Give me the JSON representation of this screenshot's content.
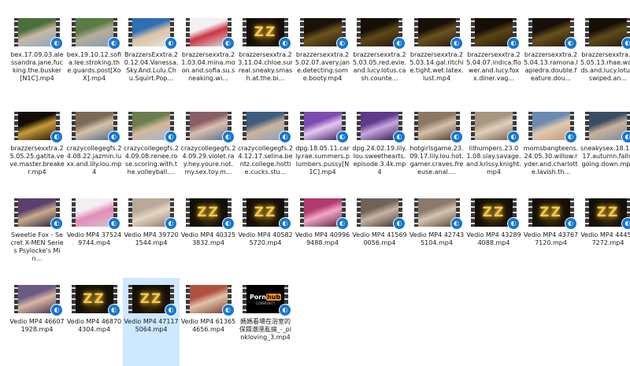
{
  "files": [
    {
      "label": "bex.17.09.03.alessandra.jane.fucking.the.busker[N1C].mp4",
      "thumb": "outdoor",
      "colors": [
        "#4c6f3a",
        "#c8b9a4",
        "#8aa6c3"
      ]
    },
    {
      "label": "bex.19.10.12.sofia.lee.stroking.the.guards.post[XoX].mp4",
      "thumb": "outdoor",
      "colors": [
        "#5b7b45",
        "#b8ad9a",
        "#7f9bb9"
      ]
    },
    {
      "label": "BrazzersExxtra.20.12.04.Vanessa.Sky.And.Lulu.Chu.Squirt.Pop...",
      "thumb": "room",
      "colors": [
        "#2f6fb3",
        "#d9c3a6",
        "#e8e2d9"
      ]
    },
    {
      "label": "brazzersexxtra.21.03.04.mina.moon.and.sofia.su.sneaking.wi...",
      "thumb": "white",
      "colors": [
        "#f1f1f1",
        "#cc3344",
        "#dddddd"
      ]
    },
    {
      "label": "brazzersexxtra.23.11.04.chloe.surreal.sneaky.smash.at.the.bi...",
      "thumb": "zz",
      "colors": []
    },
    {
      "label": "brazzersexxtra.25.02.07.avery.jane.detecting.some.booty.mp4",
      "thumb": "dark",
      "colors": [
        "#1a1208",
        "#6b5320",
        "#2a1e0c"
      ]
    },
    {
      "label": "brazzersexxtra.25.03.05.red.evie.and.lucy.lotus.cash.counte...",
      "thumb": "dark",
      "colors": [
        "#160f06",
        "#5e4818",
        "#241a0a"
      ]
    },
    {
      "label": "brazzersexxtra.25.03.14.gal.ritchie.tight.wet.latex.lust.mp4",
      "thumb": "dark",
      "colors": [
        "#18110a",
        "#6a521e",
        "#261b0c"
      ]
    },
    {
      "label": "brazzersexxtra.25.04.07.indica.flower.and.lucy.foxx.diner.vag...",
      "thumb": "dark",
      "colors": [
        "#140e06",
        "#5a4416",
        "#22190a"
      ]
    },
    {
      "label": "brazzersexxtra.25.04.13.ramona.lapiedra.double.feature.dou...",
      "thumb": "dark",
      "colors": [
        "#17100a",
        "#66501c",
        "#271c0c"
      ]
    },
    {
      "label": "brazzersexxtra.25.05.13.rhae.woods.and.lucy.lotus.swiped.an...",
      "thumb": "dark",
      "colors": [
        "#150f07",
        "#5f4a1a",
        "#241a0b"
      ]
    },
    {
      "label": "brazzersexxtra.25.05.25.gatita.veve.master.breaker.mp4",
      "thumb": "dark",
      "colors": [
        "#130d06",
        "#c99a3a",
        "#221809"
      ]
    },
    {
      "label": "crazycollegegfs.24.08.22.jazmin.luxx.and.lily.lou.mp4",
      "thumb": "room",
      "colors": [
        "#7b6a58",
        "#d7c2a8",
        "#4d6b86"
      ]
    },
    {
      "label": "crazycollegegfs.24.09.08.renee.rose.scoring.with.the.volleyball....",
      "thumb": "room",
      "colors": [
        "#6c7d4e",
        "#d3b89c",
        "#a1b4c9"
      ]
    },
    {
      "label": "crazycollegegfs.24.09.29.violet.ray.hey.youre.not.my.sex.toy.m...",
      "thumb": "room",
      "colors": [
        "#8a5f66",
        "#d9bfae",
        "#5a6f8c"
      ]
    },
    {
      "label": "crazycollegegfs.24.12.17.selina.bentz.college.hottie.cucks.stu...",
      "thumb": "room",
      "colors": [
        "#3f5d7d",
        "#cfb39a",
        "#86a0bb"
      ]
    },
    {
      "label": "dpg.18.05.11.carly.rae.summers.plumbers.pussy[N1C].mp4",
      "thumb": "purple",
      "colors": [
        "#7d4bb0",
        "#e7c8f2",
        "#3a2160"
      ]
    },
    {
      "label": "dpg.24.02.19.lily.lou.sweethearts.episode.3.4k.mp4",
      "thumb": "purple",
      "colors": [
        "#5e3a8a",
        "#c8a6df",
        "#2d1a4a"
      ]
    },
    {
      "label": "hotgirlsgame.23.09.17.lily.lou.hot.gamer.craves.freeuse.anal....",
      "thumb": "room",
      "colors": [
        "#8c7865",
        "#d6c2aa",
        "#4a3a2c"
      ]
    },
    {
      "label": "lilhumpers.23.01.08.slay.savage.and.krissy.knight.mp4",
      "thumb": "room",
      "colors": [
        "#a89682",
        "#e0d0bc",
        "#6f5f50"
      ]
    },
    {
      "label": "momsbangteens.24.05.30.willow.ryder.and.charlotte.lavish.th...",
      "thumb": "room",
      "colors": [
        "#6a8ab0",
        "#e0c9b0",
        "#c49a78"
      ]
    },
    {
      "label": "sneakysex.18.11.17.autumn.falls.going.down.mp4",
      "thumb": "room",
      "colors": [
        "#3a4e63",
        "#c9b19a",
        "#7a8c9e"
      ]
    },
    {
      "label": "Sweetie Fox - Secret X-MEN Series Psylocke's Min...",
      "thumb": "room",
      "colors": [
        "#5b3f6e",
        "#caa98e",
        "#2f2338"
      ]
    },
    {
      "label": "Vedio MP4 375249744.mp4",
      "thumb": "white",
      "colors": [
        "#f3eef2",
        "#e58bb8",
        "#cfc6cc"
      ]
    },
    {
      "label": "Vedio MP4 397201544.mp4",
      "thumb": "room",
      "colors": [
        "#b8a999",
        "#e6d6c4",
        "#8b7a6a"
      ]
    },
    {
      "label": "Vedio MP4 403253832.mp4",
      "thumb": "zz",
      "colors": []
    },
    {
      "label": "Vedio MP4 405825720.mp4",
      "thumb": "zz",
      "colors": []
    },
    {
      "label": "Vedio MP4 409969488.mp4",
      "thumb": "pink",
      "colors": [
        "#b33a6e",
        "#f1a6c8",
        "#5a1f3a"
      ]
    },
    {
      "label": "Vedio MP4 415690056.mp4",
      "thumb": "room",
      "colors": [
        "#6f6358",
        "#c8b4a0",
        "#3b342d"
      ]
    },
    {
      "label": "Vedio MP4 427435104.mp4",
      "thumb": "room",
      "colors": [
        "#8a7a6a",
        "#d8c4ae",
        "#514538"
      ]
    },
    {
      "label": "Vedio MP4 432894088.mp4",
      "thumb": "zz",
      "colors": []
    },
    {
      "label": "Vedio MP4 437677120.mp4",
      "thumb": "zz",
      "colors": []
    },
    {
      "label": "Vedio MP4 444597272.mp4",
      "thumb": "zz",
      "colors": []
    },
    {
      "label": "Vedio MP4 466071928.mp4",
      "thumb": "room",
      "colors": [
        "#6c5a86",
        "#d9b7a0",
        "#3d3050"
      ]
    },
    {
      "label": "Vedio MP4 468704304.mp4",
      "thumb": "zz",
      "colors": []
    },
    {
      "label": "Vedio MP4 471175064.mp4",
      "thumb": "zz",
      "colors": [],
      "selected": true
    },
    {
      "label": "Vedio MP4 613654656.mp4",
      "thumb": "room",
      "colors": [
        "#b05040",
        "#e0c2a8",
        "#7a3a2e"
      ]
    },
    {
      "label": "媽媽看場在浴室的保鏢潮溼亂搞_-_pinkloving_3.mp4",
      "thumb": "ph",
      "colors": []
    }
  ],
  "zz_text": "ZZ",
  "ph_logo": {
    "a": "Porn",
    "b": "hub",
    "sub": "COMMUNITY"
  },
  "badge_icon": "◐",
  "accent": "#1677d2"
}
